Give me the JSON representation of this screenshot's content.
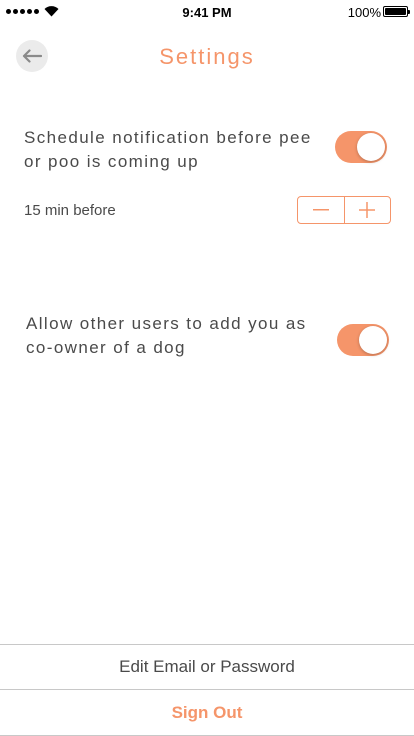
{
  "status_bar": {
    "time": "9:41 PM",
    "battery": "100%",
    "battery_level": 1.0,
    "icons": [
      "signal-icon",
      "wifi-icon",
      "battery-icon"
    ]
  },
  "header": {
    "back_icon": "arrow-left-icon",
    "title": "Settings"
  },
  "settings": {
    "notification": {
      "label": "Schedule notification before pee or poo is coming up",
      "enabled": true
    },
    "reminder": {
      "value": "15 min before",
      "decrement_icon": "minus-icon",
      "increment_icon": "plus-icon"
    },
    "co_owner": {
      "label": "Allow other users to add you as co-owner of a dog",
      "enabled": true
    }
  },
  "actions": {
    "edit": "Edit Email or Password",
    "sign_out": "Sign Out"
  },
  "colors": {
    "accent": "#f5956a",
    "text": "#4a4a4a",
    "divider": "#c8c8c8",
    "back_button_bg": "#ebebeb"
  }
}
